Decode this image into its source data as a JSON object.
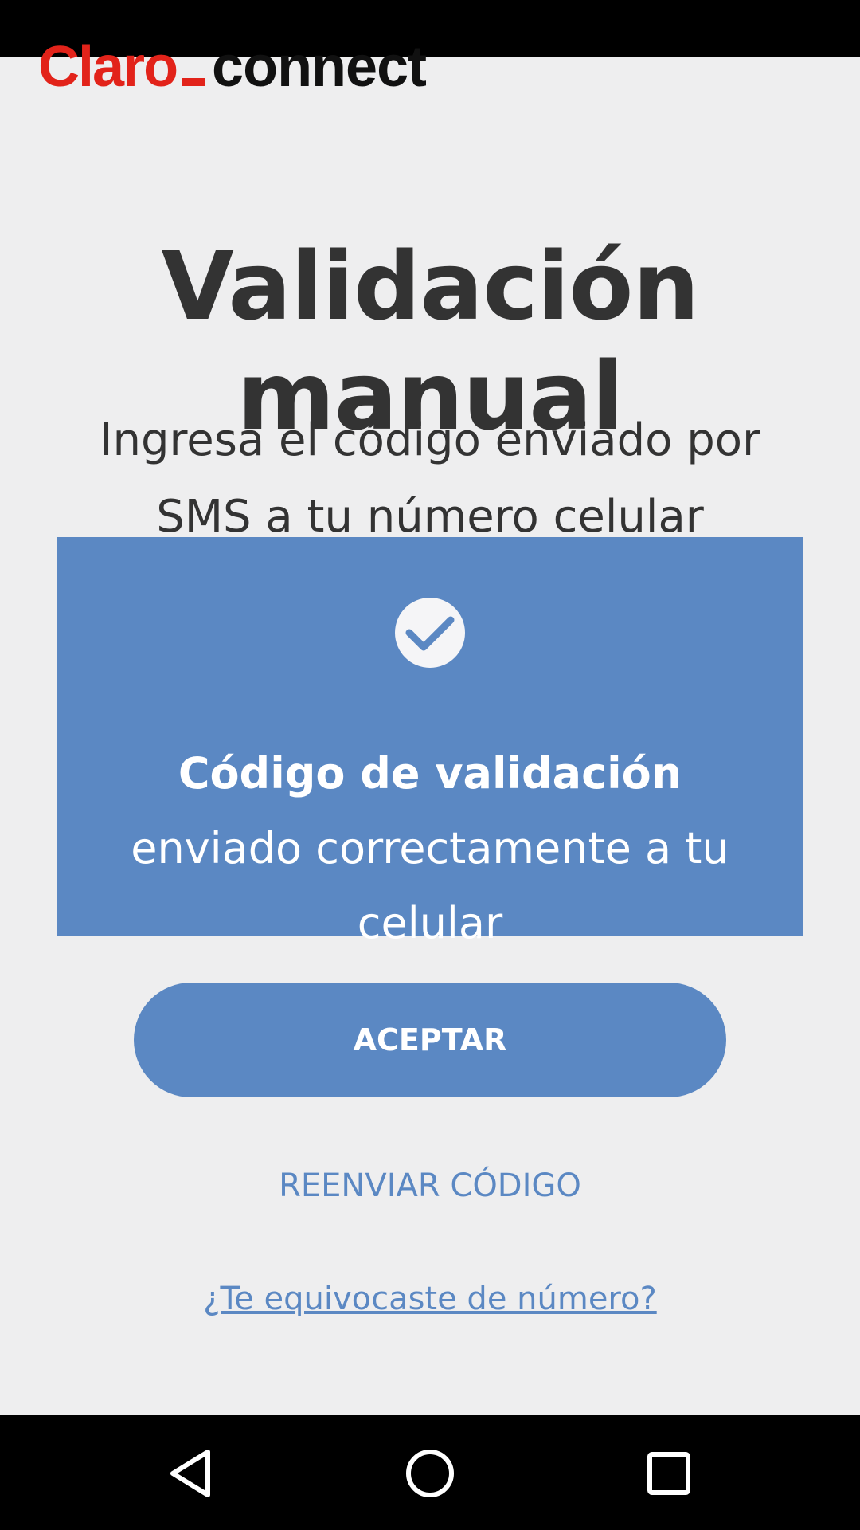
{
  "brand": {
    "claro": "Claro",
    "connect": "connect"
  },
  "page": {
    "title": "Validación manual",
    "subtitle": "Ingresa el código enviado por SMS a tu número celular"
  },
  "notice": {
    "bold_text": "Código de validación",
    "text": " enviado correctamente a tu celular"
  },
  "actions": {
    "accept_label": "ACEPTAR",
    "resend_label": "REENVIAR CÓDIGO",
    "wrong_number_label": "¿Te equivocaste de número?"
  },
  "icons": {
    "check": "check-icon",
    "back": "back-icon",
    "home": "home-icon",
    "recents": "recents-icon"
  },
  "colors": {
    "accent": "#5b88c3",
    "brand_red": "#e2231a",
    "background": "#eeeeef"
  }
}
